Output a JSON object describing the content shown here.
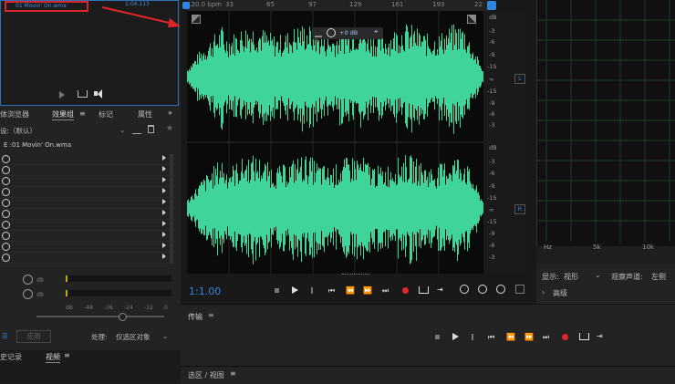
{
  "colors": {
    "accent": "#2f86e0",
    "waveform": "#3ed49a",
    "record": "#e0262a",
    "file_highlight": "#d6262a"
  },
  "files": {
    "item_name": "01 Movin' On.wma",
    "item_duration": "1:04.113"
  },
  "files_controls": [
    "play-icon",
    "loop-icon",
    "speaker-icon"
  ],
  "left_tabs": {
    "t1": "体浏览器",
    "t2": "效果组",
    "t3": "标记",
    "t4": "属性",
    "more": "»"
  },
  "preset": {
    "label": "设:",
    "value": "（默认）"
  },
  "rack_file": "E :01 Movin' On.wma",
  "rack_rows": 10,
  "meter_ticks": [
    "dB",
    "-48",
    "-36",
    "-24",
    "-12",
    "0"
  ],
  "meter_label": "dB",
  "apply": {
    "process_label": "处理:",
    "process_value": "仅选区对象",
    "apply_btn": "应用"
  },
  "bottom_tabs": {
    "t1": "史记录",
    "t2": "视频"
  },
  "ruler": {
    "label": "120.0 bpm",
    "ticks": [
      "33",
      "65",
      "97",
      "129",
      "161",
      "193",
      "22"
    ]
  },
  "hud": {
    "gain": "+0 dB"
  },
  "db_labels_top": [
    "dB",
    "-3",
    "-6",
    "-9",
    "-15",
    "∞",
    "-15",
    "-9",
    "-6",
    "-3"
  ],
  "db_labels_bottom": [
    "dB",
    "-3",
    "-6",
    "-9",
    "-15",
    "∞",
    "-15",
    "-9",
    "-6",
    "-3"
  ],
  "channel_L": "L",
  "channel_R": "R",
  "time": "1:1.00",
  "spectrum_labels": [
    "Hz",
    "5k",
    "10k"
  ],
  "display": {
    "label": "显示:",
    "value": "视形",
    "channel_label": "观察声道:",
    "channel_value": "左侧",
    "advanced": "高级"
  },
  "transport_title": "传输",
  "selection_view": "选区 / 视图"
}
